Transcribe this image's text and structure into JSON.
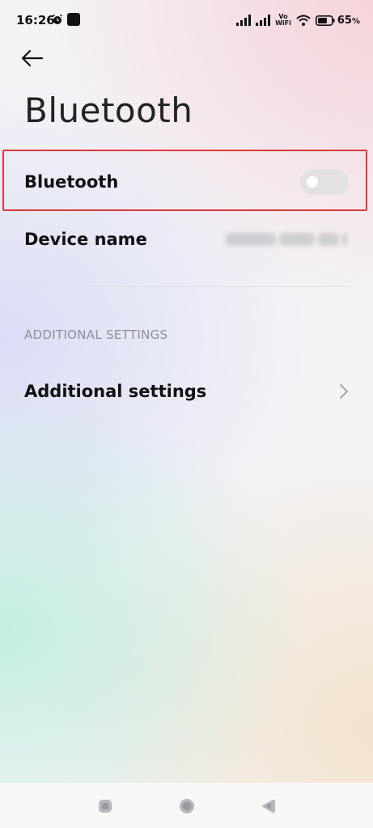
{
  "status_bar": {
    "time": "16:26",
    "vowifi_top": "Vo",
    "vowifi_bottom": "WiFi",
    "battery_percent": "65",
    "battery_unit": "%"
  },
  "header": {
    "title": "Bluetooth"
  },
  "settings": {
    "bluetooth_label": "Bluetooth",
    "bluetooth_enabled": false,
    "device_name_label": "Device name"
  },
  "sections": {
    "additional_header": "ADDITIONAL SETTINGS",
    "additional_item_label": "Additional settings"
  },
  "colors": {
    "highlight": "#d83a3a",
    "toggle_off": "#e3e1e3"
  },
  "icons": {
    "back": "back-arrow-icon",
    "chevron": "chevron-right-icon",
    "alarm": "alarm-icon",
    "wifi": "wifi-icon",
    "battery": "battery-icon",
    "signal": "signal-icon"
  }
}
